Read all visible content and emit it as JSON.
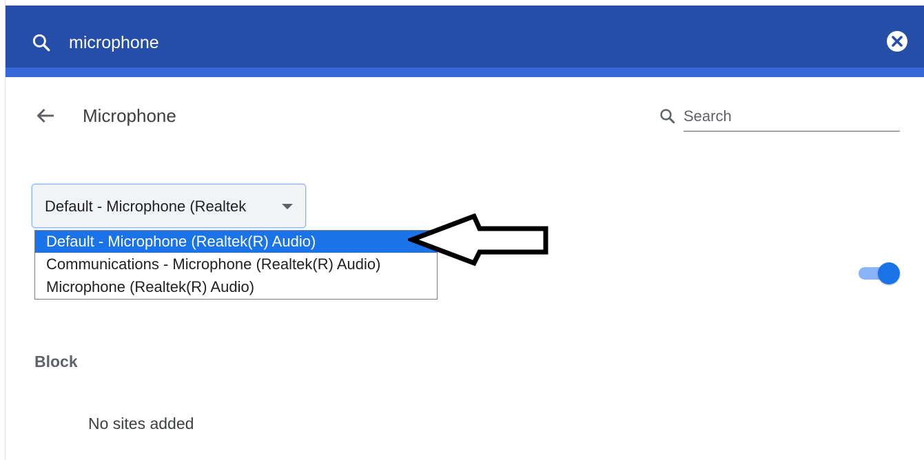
{
  "header": {
    "search_query": "microphone",
    "search_icon": "search-icon",
    "clear_icon": "clear-circle-icon",
    "background_color": "#254ea8",
    "accent_color": "#3567d6"
  },
  "page": {
    "title": "Microphone",
    "back_icon": "arrow-back-icon",
    "search": {
      "placeholder": "Search",
      "value": ""
    }
  },
  "microphone_select": {
    "selected_label": "Default - Microphone (Realtek",
    "options": [
      {
        "label": "Default - Microphone (Realtek(R) Audio)",
        "selected": true
      },
      {
        "label": "Communications - Microphone (Realtek(R) Audio)",
        "selected": false
      },
      {
        "label": "Microphone (Realtek(R) Audio)",
        "selected": false
      }
    ],
    "highlight_color": "#1a73e8"
  },
  "ask_toggle": {
    "state": "on",
    "color": "#1a73e8"
  },
  "block_section": {
    "heading": "Block",
    "empty_text": "No sites added"
  },
  "annotation": {
    "icon": "pointer-arrow-icon"
  }
}
